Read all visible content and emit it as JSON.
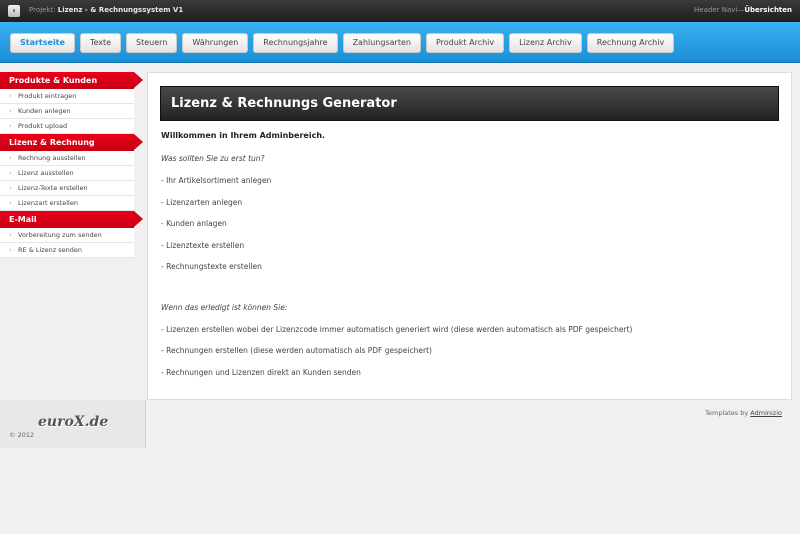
{
  "topbar": {
    "back_label": "‹",
    "project_prefix": "Projekt: ",
    "project_name": "Lizenz - & Rechnungssystem V1",
    "header_nav_prefix": "Header Navi—",
    "header_nav_link": "Übersichten"
  },
  "nav": {
    "tabs": [
      "Startseite",
      "Texte",
      "Steuern",
      "Währungen",
      "Rechnungsjahre",
      "Zahlungsarten",
      "Produkt Archiv",
      "Lizenz Archiv",
      "Rechnung Archiv"
    ],
    "active_index": 0,
    "active_color": "#1a8fd8"
  },
  "sidebar": {
    "sections": [
      {
        "title": "Produkte & Kunden",
        "items": [
          "Produkt eintragen",
          "Kunden anlegen",
          "Produkt upload"
        ]
      },
      {
        "title": "Lizenz & Rechnung",
        "items": [
          "Rechnung ausstellen",
          "Lizenz ausstellen",
          "Lizenz-Texte erstellen",
          "Lizenzart erstellen"
        ]
      },
      {
        "title": "E-Mail",
        "items": [
          "Vorbereitung zum senden",
          "RE & Lizenz senden"
        ]
      }
    ],
    "header_color": "#d5001a"
  },
  "content": {
    "title": "Lizenz & Rechnungs Generator",
    "welcome": "Willkommen in Ihrem Adminbereich.",
    "question": "Was sollten Sie zu erst tun?",
    "steps": [
      "- Ihr Artikelsortiment anlegen",
      "- Lizenzarten anlegen",
      "- Kunden anlagen",
      "- Lizenztexte erstellen",
      "- Rechnungstexte erstellen"
    ],
    "then_intro": "Wenn das erledigt ist können Sie:",
    "then_items": [
      "- Lizenzen erstellen wobei der Lizenzcode immer automatisch generiert wird (diese werden automatisch als PDF gespeichert)",
      "- Rechnungen erstellen (diese werden automatisch als PDF gespeichert)",
      "- Rechnungen und Lizenzen direkt an Kunden senden"
    ]
  },
  "footer": {
    "logo": "euroX.de",
    "copyright": "© 2012",
    "templates_prefix": "Templates by ",
    "templates_link": "Adminizio"
  }
}
